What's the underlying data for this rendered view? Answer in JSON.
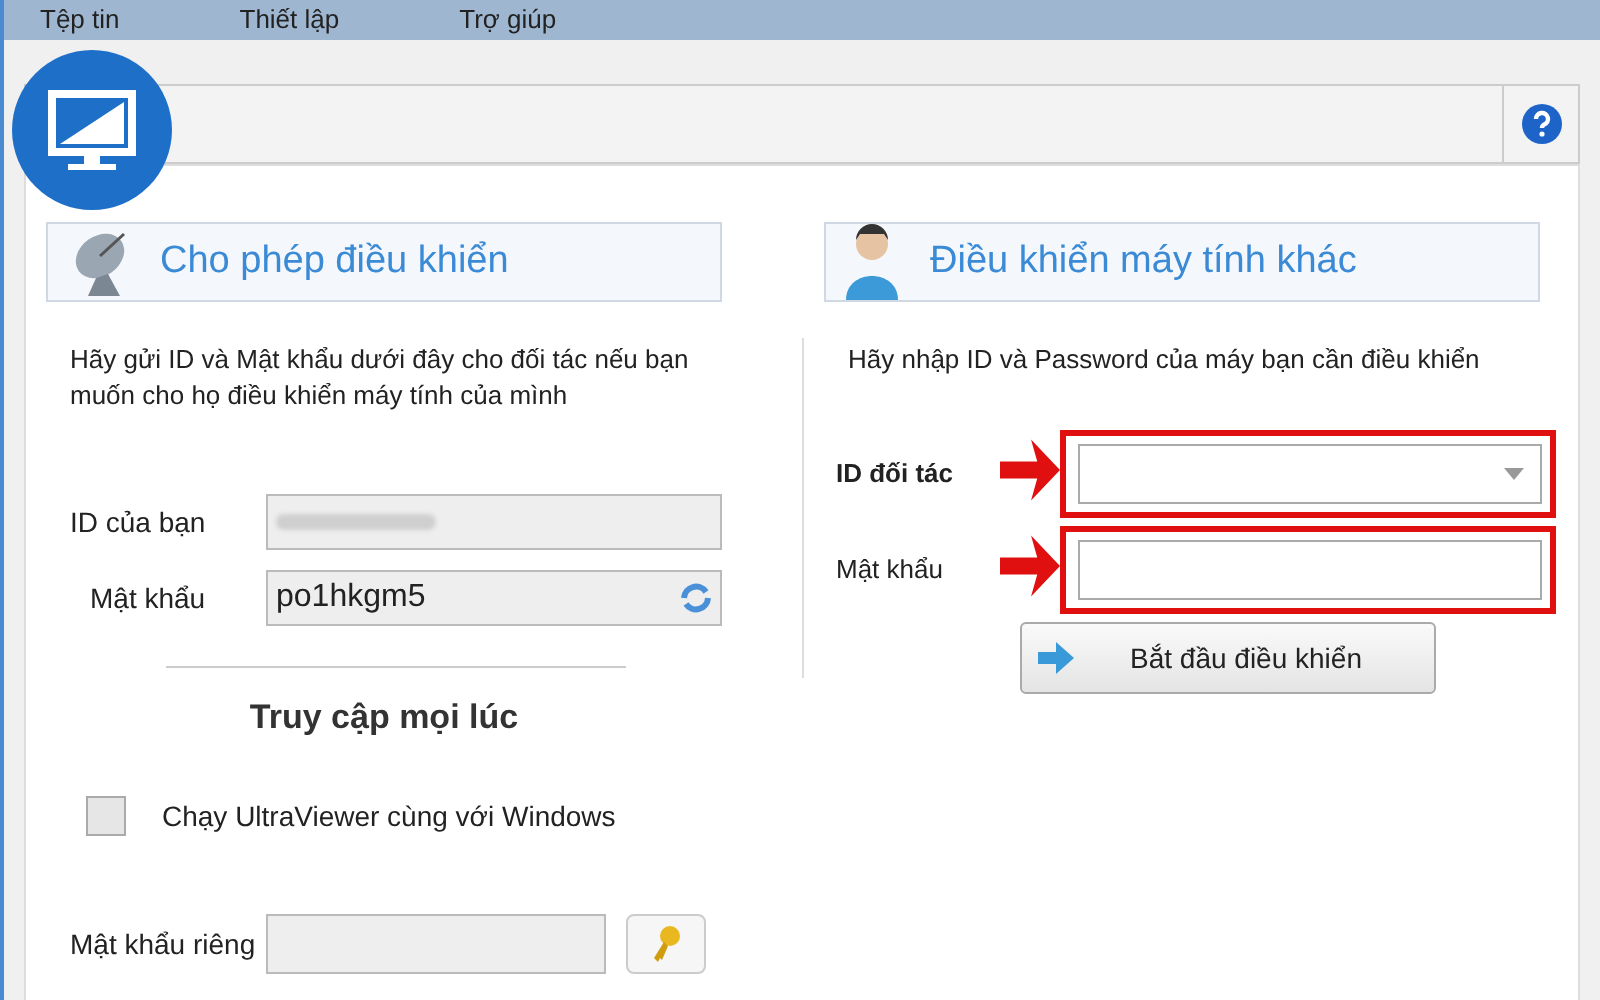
{
  "menu": [
    "Tệp tin",
    "Thiết lập",
    "Trợ giúp"
  ],
  "allow_control": {
    "title": "Cho phép điều khiển",
    "description": "Hãy gửi ID và Mật khẩu dưới đây cho đối tác nếu bạn muốn cho họ điều khiển máy tính của mình",
    "id_label": "ID của bạn",
    "password_label": "Mật khẩu",
    "password_value": "po1hkgm5"
  },
  "always_access": {
    "title": "Truy cập mọi lúc",
    "checkbox": {
      "label": "Chạy UltraViewer cùng với Windows",
      "checked": false
    },
    "personal_password_label": "Mật khẩu riêng"
  },
  "control_other": {
    "title": "Điều khiển máy tính khác",
    "description": "Hãy nhập ID và Password của máy bạn cần điều khiển",
    "fields": [
      {
        "kind": "combo",
        "label": "ID đối tác",
        "highlighted": true
      },
      {
        "kind": "text",
        "label": "Mật khẩu",
        "highlighted": true
      }
    ],
    "start_button": "Bắt đầu điều khiển"
  }
}
